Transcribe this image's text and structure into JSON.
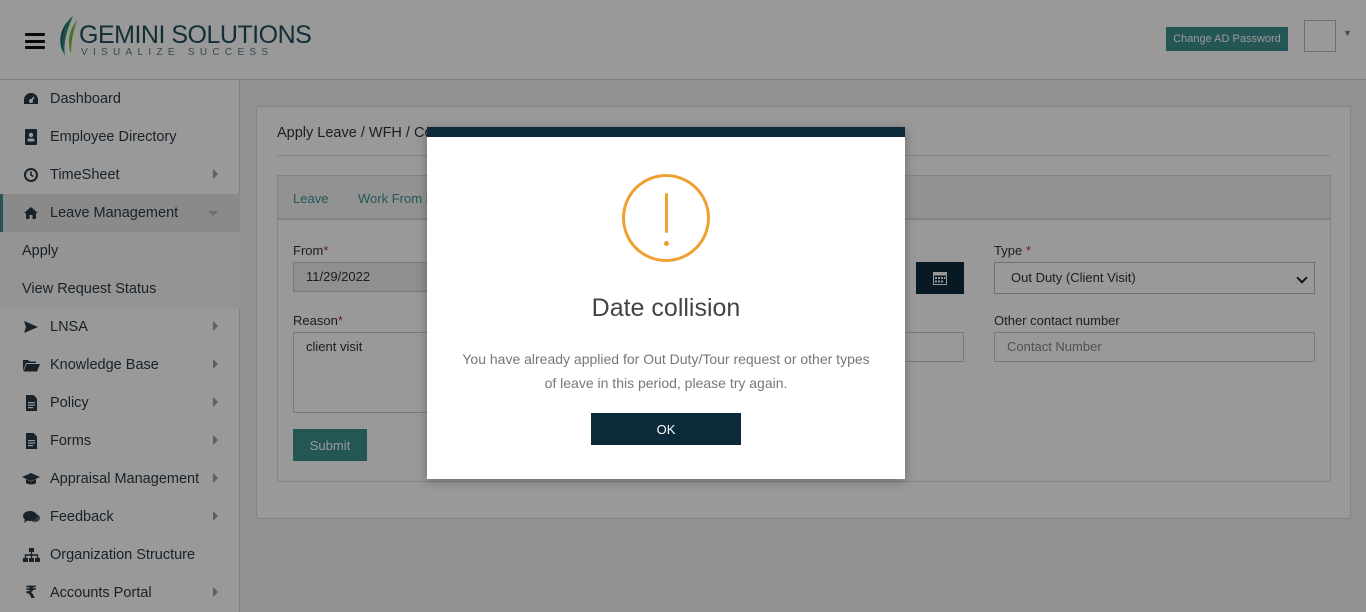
{
  "header": {
    "logo_main": "GEMINI SOLUTIONS",
    "logo_tagline": "VISUALIZE SUCCESS",
    "change_ad_password": "Change AD Password"
  },
  "sidebar": {
    "items": [
      {
        "label": "Dashboard",
        "icon": "dashboard-icon"
      },
      {
        "label": "Employee Directory",
        "icon": "contact-card-icon"
      },
      {
        "label": "TimeSheet",
        "icon": "clock-icon"
      },
      {
        "label": "Leave Management",
        "icon": "home-icon"
      },
      {
        "label": "Apply"
      },
      {
        "label": "View Request Status"
      },
      {
        "label": "LNSA",
        "icon": "plane-icon"
      },
      {
        "label": "Knowledge Base",
        "icon": "folder-open-icon"
      },
      {
        "label": "Policy",
        "icon": "file-icon"
      },
      {
        "label": "Forms",
        "icon": "file-icon"
      },
      {
        "label": "Appraisal Management",
        "icon": "graduation-cap-icon"
      },
      {
        "label": "Feedback",
        "icon": "comments-icon"
      },
      {
        "label": "Organization Structure",
        "icon": "sitemap-icon"
      },
      {
        "label": "Accounts Portal",
        "icon": "rupee-icon"
      }
    ]
  },
  "main": {
    "title": "Apply Leave / WFH / Co",
    "tabs": [
      "Leave",
      "Work From H"
    ],
    "from_label": "From",
    "from_value": "11/29/2022",
    "type_label": "Type",
    "type_value": "Out Duty (Client Visit)",
    "reason_label": "Reason",
    "reason_value": "client visit",
    "other_contact_label": "Other contact number",
    "other_contact_placeholder": "Contact Number",
    "submit_label": "Submit",
    "required_mark": "*"
  },
  "modal": {
    "title": "Date collision",
    "message": "You have already applied for Out Duty/Tour request or other types of leave in this period, please try again.",
    "ok_label": "OK",
    "icon": "warning-icon",
    "accent_color": "#f0a030",
    "bar_color": "#0d2a3a"
  }
}
